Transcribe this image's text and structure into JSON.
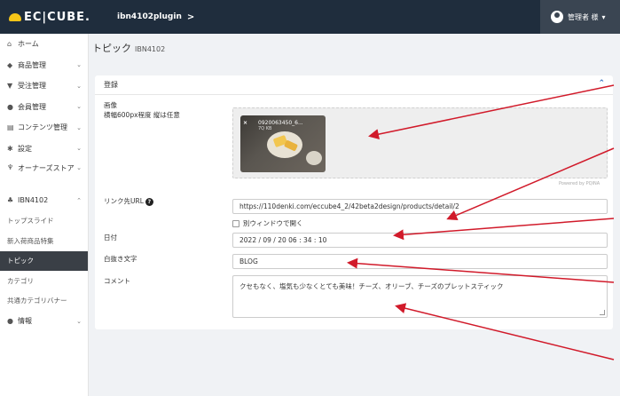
{
  "header": {
    "logo_text": "EC|CUBE.",
    "shop_name": "ibn4102plugin",
    "shop_chevron": ">",
    "user_name": "管理者 様",
    "user_chevron": "▾"
  },
  "sidebar": {
    "items": [
      {
        "icon": "home-icon",
        "glyph": "⌂",
        "label": "ホーム"
      },
      {
        "icon": "product-icon",
        "glyph": "◆",
        "label": "商品管理",
        "chevron": "⌄"
      },
      {
        "icon": "cart-icon",
        "glyph": "▼",
        "label": "受注管理",
        "chevron": "⌄"
      },
      {
        "icon": "members-icon",
        "glyph": "●",
        "label": "会員管理",
        "chevron": "⌄"
      },
      {
        "icon": "content-icon",
        "glyph": "▤",
        "label": "コンテンツ管理",
        "chevron": "⌄"
      },
      {
        "icon": "gear-icon",
        "glyph": "✱",
        "label": "設定",
        "chevron": "⌄"
      },
      {
        "icon": "plug-icon",
        "glyph": "♆",
        "label": "オーナーズストア",
        "chevron": "⌄"
      },
      {
        "icon": "ibn-icon",
        "glyph": "♣",
        "label": "IBN4102",
        "chevron": "⌃"
      }
    ],
    "subitems": [
      {
        "label": "トップスライド",
        "active": false
      },
      {
        "label": "新入荷商品特集",
        "active": false
      },
      {
        "label": "トピック",
        "active": true
      },
      {
        "label": "カテゴリ",
        "active": false
      },
      {
        "label": "共通カテゴリバナー",
        "active": false
      }
    ],
    "info": {
      "icon": "info-icon",
      "glyph": "●",
      "label": "情報",
      "chevron": "⌄"
    }
  },
  "page": {
    "title": "トピック",
    "code": "IBN4102"
  },
  "card": {
    "title": "登録",
    "collapse_glyph": "⌃"
  },
  "form": {
    "image_label": "画像",
    "image_hint": "横幅600px程度 縦は任意",
    "file_name": "0920063450_6...",
    "file_size": "7Q KB",
    "file_remove": "×",
    "powered_by": "Powered by PQINA",
    "link_label": "リンク先URL",
    "help_glyph": "?",
    "link_value": "https://110denki.com/eccube4_2/42beta2design/products/detail/2",
    "new_window_label": "別ウィンドウで開く",
    "date_label": "日付",
    "date_value": "2022 / 09 / 20 06 : 34 : 10",
    "white_text_label": "白抜き文字",
    "white_text_value": "BLOG",
    "comment_label": "コメント",
    "comment_value": "クセもなく、塩気も少なくとても美味！チーズ、オリーブ、チーズのプレットスティック"
  },
  "annotation_color": "#d11a2a"
}
